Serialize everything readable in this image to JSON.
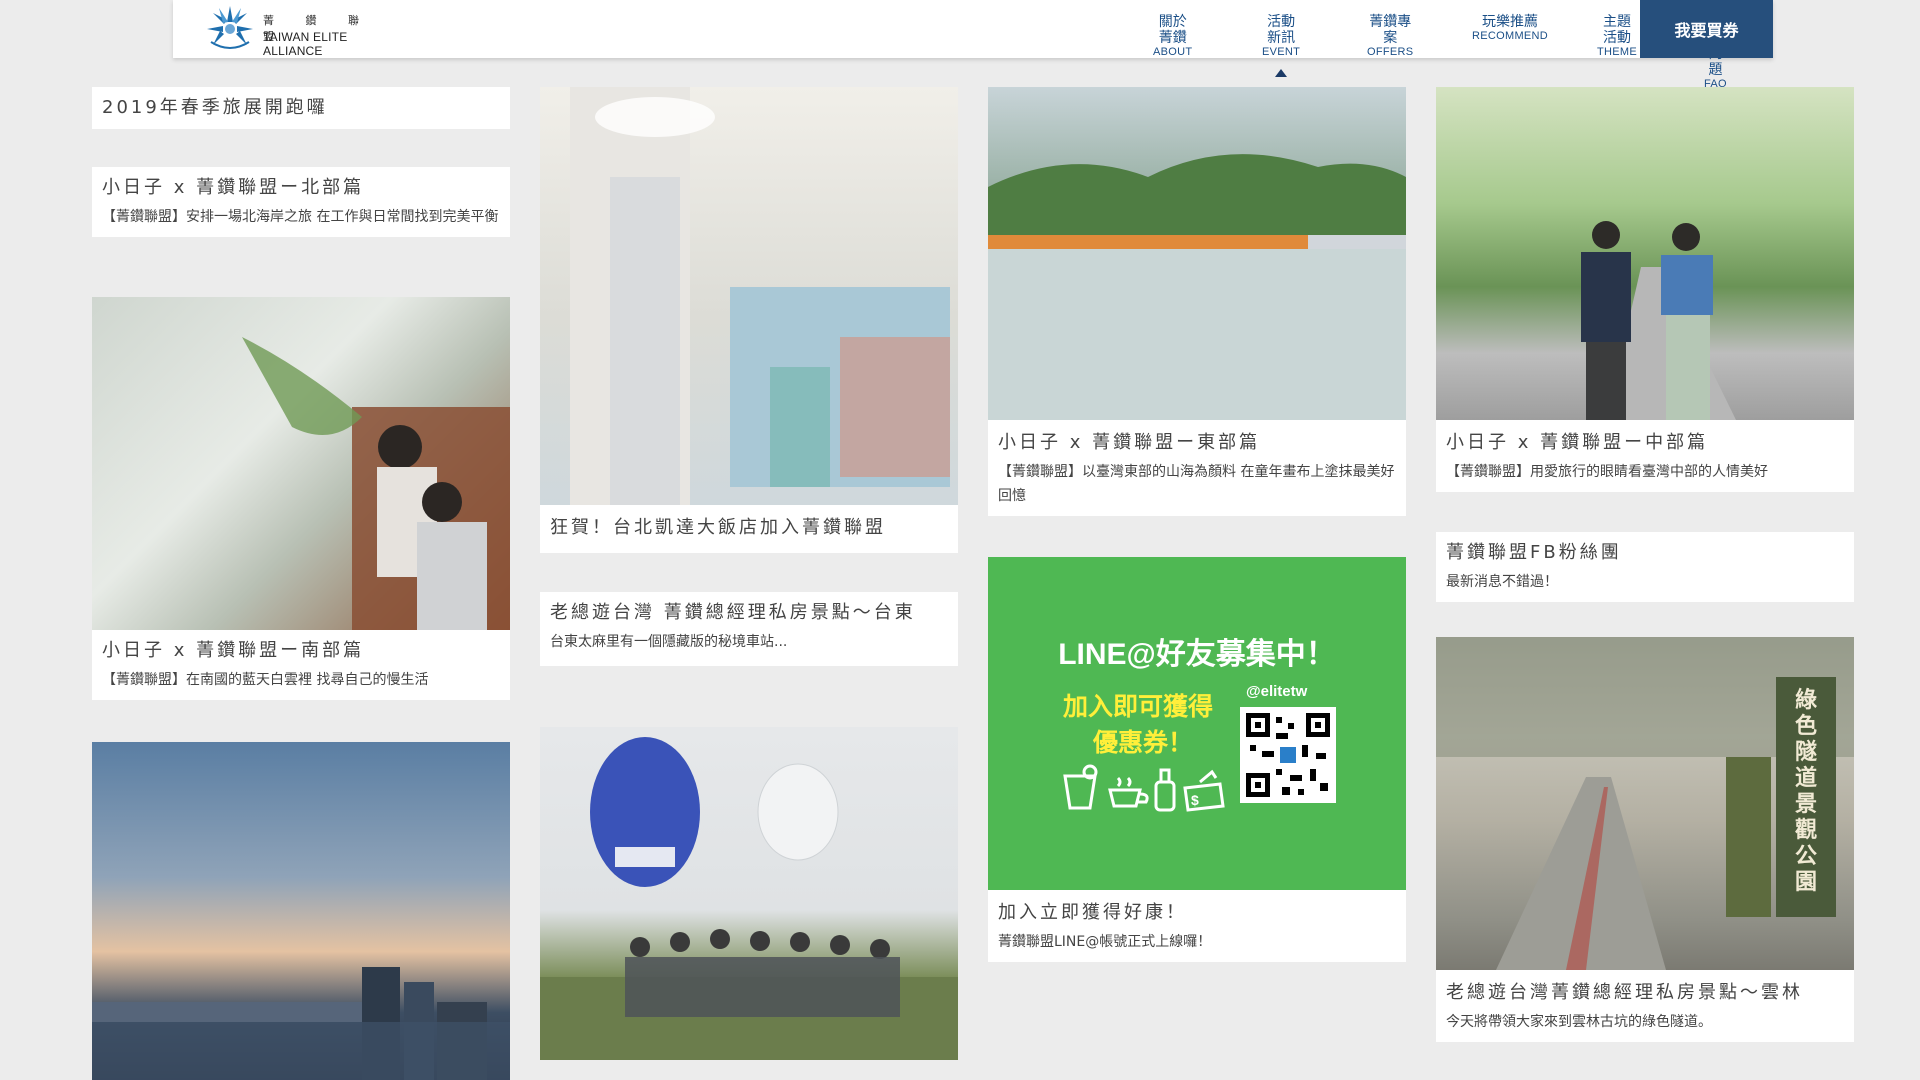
{
  "header": {
    "logo_cn": "菁 鑽 聯 盟",
    "logo_en": "TAIWAN ELITE ALLIANCE",
    "nav": [
      {
        "cn": "關於菁鑽",
        "en": "ABOUT"
      },
      {
        "cn": "活動新訊",
        "en": "EVENT"
      },
      {
        "cn": "菁鑽專案",
        "en": "OFFERS"
      },
      {
        "cn": "玩樂推薦",
        "en": "RECOMMEND"
      },
      {
        "cn": "主題活動",
        "en": "THEME"
      },
      {
        "cn": "常見問題",
        "en": "FAQ"
      }
    ],
    "active_nav": "EVENT",
    "buy_label": "我要買券",
    "brand_color": "#264f7c"
  },
  "cards": {
    "spring_travel": {
      "title": "2019年春季旅展開跑囉"
    },
    "north": {
      "title": "小日子 x 菁鑽聯盟ー北部篇",
      "desc": "【菁鑽聯盟】安排一場北海岸之旅 在工作與日常間找到完美平衡"
    },
    "south": {
      "title": "小日子 x 菁鑽聯盟ー南部篇",
      "desc": "【菁鑽聯盟】在南國的藍天白雲裡 找尋自己的慢生活"
    },
    "grand_hotel": {
      "title": "狂賀！台北凱達大飯店加入菁鑽聯盟"
    },
    "taitung": {
      "title": "老總遊台灣 菁鑽總經理私房景點～台東",
      "desc": "台東太麻里有一個隱藏版的秘境車站..."
    },
    "east": {
      "title": "小日子 x 菁鑽聯盟ー東部篇",
      "desc": "【菁鑽聯盟】以臺灣東部的山海為顏料 在童年畫布上塗抹最美好回憶"
    },
    "line": {
      "title": "加入立即獲得好康！",
      "desc": "菁鑽聯盟LINE@帳號正式上線囉！",
      "banner_title": "LINE@好友募集中！",
      "banner_line1": "加入即可獲得",
      "banner_line2": "優惠券！",
      "banner_id": "@elitetw"
    },
    "central": {
      "title": "小日子 x 菁鑽聯盟ー中部篇",
      "desc": "【菁鑽聯盟】用愛旅行的眼睛看臺灣中部的人情美好"
    },
    "fb": {
      "title": "菁鑽聯盟FB粉絲團",
      "desc": "最新消息不錯過！"
    },
    "yunlin": {
      "title": "老總遊台灣菁鑽總經理私房景點～雲林",
      "desc": "今天將帶領大家來到雲林古坑的綠色隧道。",
      "sign_text": "綠色隧道景觀公園"
    }
  }
}
